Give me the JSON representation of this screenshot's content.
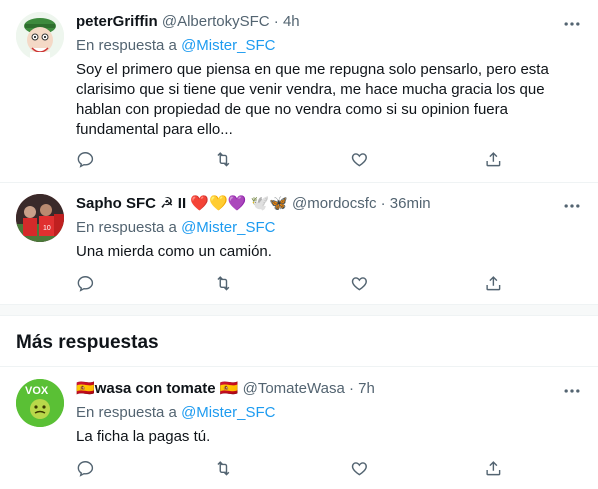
{
  "tweets": [
    {
      "name": "peterGriffin",
      "handle": "@AlbertokySFC",
      "separator": "·",
      "time": "4h",
      "reply_prefix": "En respuesta a",
      "reply_handle": "@Mister_SFC",
      "text": "Soy el primero que piensa en que me repugna solo pensarlo, pero esta clarisimo que si tiene que venir vendra, me hace mucha gracia los que hablan con propiedad de que no vendra como si su opinion fuera fundamental para ello..."
    },
    {
      "name": "Sapho SFC",
      "name_emoji": " ☭ II ❤️💛💜 🕊️🦋",
      "handle": "@mordocsfc",
      "separator": "·",
      "time": "36min",
      "reply_prefix": "En respuesta a",
      "reply_handle": "@Mister_SFC",
      "text": "Una mierda como un camión."
    },
    {
      "name_prefix_emoji": "🇪🇸",
      "name": "wasa con tomate",
      "name_emoji": " 🇪🇸",
      "handle": "@TomateWasa",
      "separator": "·",
      "time": "7h",
      "reply_prefix": "En respuesta a",
      "reply_handle": "@Mister_SFC",
      "text": "La ficha la pagas tú."
    }
  ],
  "more_replies_heading": "Más respuestas",
  "colors": {
    "accent": "#1d9bf0",
    "secondary_text": "#536471",
    "primary_text": "#0f1419",
    "vox_green": "#5ac035"
  },
  "icons": [
    "more-icon",
    "reply-icon",
    "retweet-icon",
    "like-icon",
    "share-icon"
  ]
}
